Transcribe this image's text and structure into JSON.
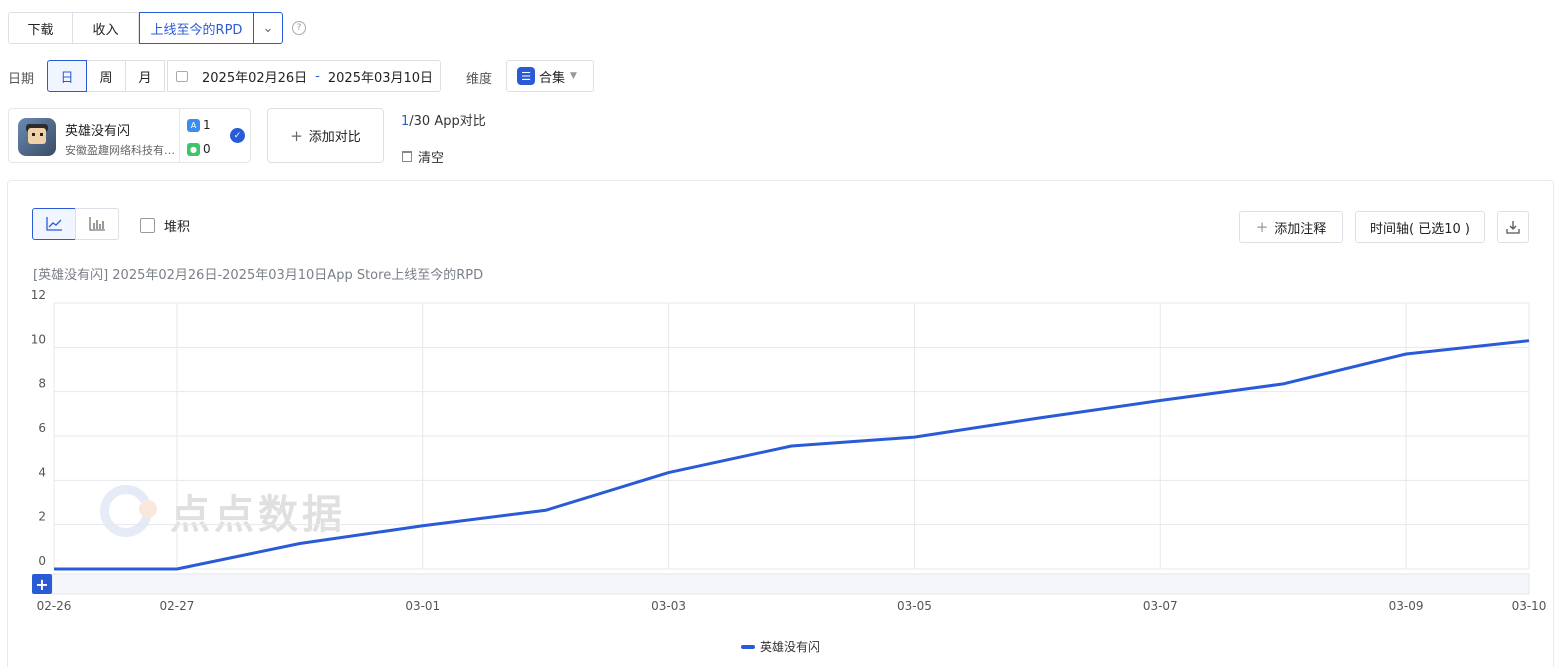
{
  "metric_tabs": {
    "download": "下载",
    "revenue": "收入",
    "rpd": "上线至今的RPD",
    "help": "?"
  },
  "date": {
    "label": "日期",
    "granularity": [
      "日",
      "周",
      "月"
    ],
    "start": "2025年02月26日",
    "separator": "-",
    "end": "2025年03月10日"
  },
  "dimension": {
    "label": "维度",
    "value": "合集"
  },
  "app": {
    "name": "英雄没有闪",
    "developer": "安徽盈趣网络科技有限公司",
    "ios_count": "1",
    "android_count": "0"
  },
  "compare": {
    "add_label": "添加对比",
    "count_current": "1",
    "count_rest": "/30 App对比",
    "clear_label": "清空"
  },
  "toolbar": {
    "stack_label": "堆积",
    "add_note": "添加注释",
    "timeline": "时间轴( 已选10 )"
  },
  "chart_subtitle": "[英雄没有闪] 2025年02月26日-2025年03月10日App Store上线至今的RPD",
  "watermark": "点点数据",
  "colors": {
    "accent": "#2a5bd7",
    "grid": "#e6e8ec"
  },
  "chart_data": {
    "type": "line",
    "title": "",
    "xlabel": "",
    "ylabel": "",
    "x": [
      "02-26",
      "02-27",
      "02-28",
      "03-01",
      "03-02",
      "03-03",
      "03-04",
      "03-05",
      "03-06",
      "03-07",
      "03-08",
      "03-09",
      "03-10"
    ],
    "x_tick_labels": [
      "02-26",
      "02-27",
      "03-01",
      "03-03",
      "03-05",
      "03-07",
      "03-09",
      "03-10"
    ],
    "ylim": [
      0,
      12
    ],
    "y_ticks": [
      0,
      2,
      4,
      6,
      8,
      10,
      12
    ],
    "grid": true,
    "legend": "bottom-center",
    "series": [
      {
        "name": "英雄没有闪",
        "values": [
          0,
          0,
          1.15,
          1.95,
          2.65,
          4.35,
          5.55,
          5.95,
          6.8,
          7.6,
          8.35,
          9.7,
          10.3
        ]
      }
    ]
  }
}
